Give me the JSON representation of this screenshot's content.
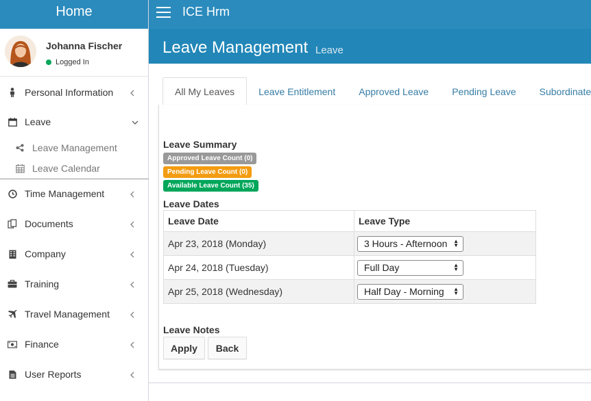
{
  "sidebar": {
    "brand": "Home",
    "user": {
      "name": "Johanna Fischer",
      "status": "Logged In"
    },
    "items": [
      {
        "label": "Personal Information",
        "icon": "person-icon"
      },
      {
        "label": "Leave",
        "icon": "calendar-icon"
      },
      {
        "label": "Time Management",
        "icon": "clock-icon"
      },
      {
        "label": "Documents",
        "icon": "documents-icon"
      },
      {
        "label": "Company",
        "icon": "building-icon"
      },
      {
        "label": "Training",
        "icon": "briefcase-icon"
      },
      {
        "label": "Travel Management",
        "icon": "plane-icon"
      },
      {
        "label": "Finance",
        "icon": "money-icon"
      },
      {
        "label": "User Reports",
        "icon": "report-icon"
      }
    ],
    "leave_submenu": [
      {
        "label": "Leave Management",
        "icon": "share-icon"
      },
      {
        "label": "Leave Calendar",
        "icon": "calendar-grid-icon"
      }
    ]
  },
  "header": {
    "app_title": "ICE Hrm",
    "page_title": "Leave Management",
    "page_subtitle": "Leave"
  },
  "tabs": [
    {
      "label": "All My Leaves",
      "active": true
    },
    {
      "label": "Leave Entitlement",
      "active": false
    },
    {
      "label": "Approved Leave",
      "active": false
    },
    {
      "label": "Pending Leave",
      "active": false
    },
    {
      "label": "Subordinate L",
      "active": false
    }
  ],
  "summary": {
    "heading": "Leave Summary",
    "badges": [
      {
        "label": "Approved Leave Count (0)",
        "color": "#999999"
      },
      {
        "label": "Pending Leave Count (0)",
        "color": "#f39c12"
      },
      {
        "label": "Available Leave Count (35)",
        "color": "#00a65a"
      }
    ]
  },
  "leave_dates": {
    "heading": "Leave Dates",
    "columns": [
      "Leave Date",
      "Leave Type"
    ],
    "rows": [
      {
        "date": "Apr 23, 2018 (Monday)",
        "type": "3 Hours - Afternoon"
      },
      {
        "date": "Apr 24, 2018 (Tuesday)",
        "type": "Full Day"
      },
      {
        "date": "Apr 25, 2018 (Wednesday)",
        "type": "Half Day - Morning"
      }
    ]
  },
  "notes": {
    "heading": "Leave Notes"
  },
  "actions": {
    "apply_label": "Apply",
    "back_label": "Back"
  }
}
